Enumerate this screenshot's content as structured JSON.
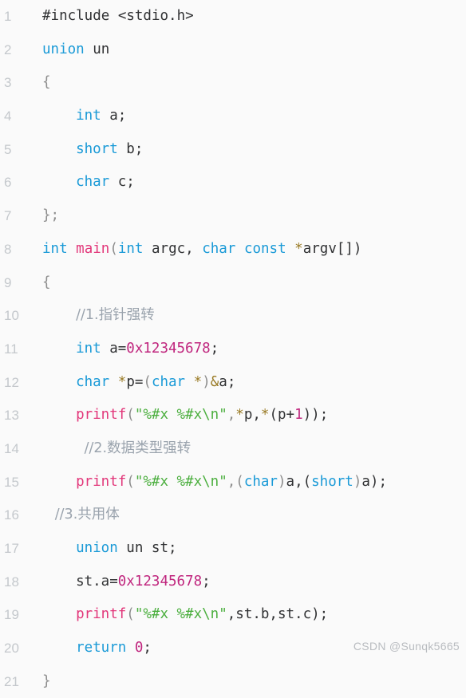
{
  "editor": {
    "language": "c",
    "background_color": "#fafafa",
    "line_number_color": "#c4c8cc",
    "default_text_color": "#303133",
    "token_colors": {
      "keyword": "#1a9ad7",
      "function": "#e2377a",
      "string": "#4caf3f",
      "number": "#c0267e",
      "comment": "#9aa3ad",
      "punctuation": "#8d8d8d",
      "operator": "#9a7b26"
    },
    "first_visible_line": 1,
    "last_visible_line": 21,
    "lines": [
      {
        "number": "1",
        "indent": 0,
        "tokens": [
          {
            "text": "#include <stdio.h>",
            "type": "plain"
          }
        ]
      },
      {
        "number": "2",
        "indent": 0,
        "tokens": [
          {
            "text": "union",
            "type": "keyword"
          },
          {
            "text": " un",
            "type": "plain"
          }
        ]
      },
      {
        "number": "3",
        "indent": 0,
        "tokens": [
          {
            "text": "{",
            "type": "punctuation"
          }
        ]
      },
      {
        "number": "4",
        "indent": 4,
        "tokens": [
          {
            "text": "int",
            "type": "keyword"
          },
          {
            "text": " a;",
            "type": "plain"
          }
        ]
      },
      {
        "number": "5",
        "indent": 4,
        "tokens": [
          {
            "text": "short",
            "type": "keyword"
          },
          {
            "text": " b;",
            "type": "plain"
          }
        ]
      },
      {
        "number": "6",
        "indent": 4,
        "tokens": [
          {
            "text": "char",
            "type": "keyword"
          },
          {
            "text": " c;",
            "type": "plain"
          }
        ]
      },
      {
        "number": "7",
        "indent": 0,
        "tokens": [
          {
            "text": "};",
            "type": "punctuation"
          }
        ]
      },
      {
        "number": "8",
        "indent": 0,
        "tokens": [
          {
            "text": "int",
            "type": "keyword"
          },
          {
            "text": " ",
            "type": "plain"
          },
          {
            "text": "main",
            "type": "function"
          },
          {
            "text": "(",
            "type": "punctuation"
          },
          {
            "text": "int",
            "type": "keyword"
          },
          {
            "text": " argc, ",
            "type": "plain"
          },
          {
            "text": "char",
            "type": "keyword"
          },
          {
            "text": " ",
            "type": "plain"
          },
          {
            "text": "const",
            "type": "keyword"
          },
          {
            "text": " ",
            "type": "plain"
          },
          {
            "text": "*",
            "type": "operator"
          },
          {
            "text": "argv[])",
            "type": "plain"
          }
        ]
      },
      {
        "number": "9",
        "indent": 0,
        "tokens": [
          {
            "text": "{",
            "type": "punctuation"
          }
        ]
      },
      {
        "number": "10",
        "indent": 4,
        "tokens": [
          {
            "text": "//1.指针强转",
            "type": "comment"
          }
        ]
      },
      {
        "number": "11",
        "indent": 4,
        "tokens": [
          {
            "text": "int",
            "type": "keyword"
          },
          {
            "text": " a=",
            "type": "plain"
          },
          {
            "text": "0x12345678",
            "type": "number"
          },
          {
            "text": ";",
            "type": "plain"
          }
        ]
      },
      {
        "number": "12",
        "indent": 4,
        "tokens": [
          {
            "text": "char",
            "type": "keyword"
          },
          {
            "text": " ",
            "type": "plain"
          },
          {
            "text": "*",
            "type": "operator"
          },
          {
            "text": "p=",
            "type": "plain"
          },
          {
            "text": "(",
            "type": "punctuation"
          },
          {
            "text": "char",
            "type": "keyword"
          },
          {
            "text": " ",
            "type": "plain"
          },
          {
            "text": "*",
            "type": "operator"
          },
          {
            "text": ")",
            "type": "punctuation"
          },
          {
            "text": "&",
            "type": "operator"
          },
          {
            "text": "a;",
            "type": "plain"
          }
        ]
      },
      {
        "number": "13",
        "indent": 4,
        "tokens": [
          {
            "text": "printf",
            "type": "function"
          },
          {
            "text": "(",
            "type": "punctuation"
          },
          {
            "text": "\"%#x %#x\\n\"",
            "type": "string"
          },
          {
            "text": ",",
            "type": "punctuation"
          },
          {
            "text": "*",
            "type": "operator"
          },
          {
            "text": "p,",
            "type": "plain"
          },
          {
            "text": "*",
            "type": "operator"
          },
          {
            "text": "(p+",
            "type": "plain"
          },
          {
            "text": "1",
            "type": "number"
          },
          {
            "text": "));",
            "type": "plain"
          }
        ]
      },
      {
        "number": "14",
        "indent": 5,
        "tokens": [
          {
            "text": "//2.数据类型强转",
            "type": "comment"
          }
        ]
      },
      {
        "number": "15",
        "indent": 4,
        "tokens": [
          {
            "text": "printf",
            "type": "function"
          },
          {
            "text": "(",
            "type": "punctuation"
          },
          {
            "text": "\"%#x %#x\\n\"",
            "type": "string"
          },
          {
            "text": ",(",
            "type": "punctuation"
          },
          {
            "text": "char",
            "type": "keyword"
          },
          {
            "text": ")",
            "type": "punctuation"
          },
          {
            "text": "a,(",
            "type": "plain"
          },
          {
            "text": "short",
            "type": "keyword"
          },
          {
            "text": ")",
            "type": "punctuation"
          },
          {
            "text": "a);",
            "type": "plain"
          }
        ]
      },
      {
        "number": "16",
        "indent": 1.5,
        "tokens": [
          {
            "text": "//3.共用体",
            "type": "comment"
          }
        ]
      },
      {
        "number": "17",
        "indent": 4,
        "tokens": [
          {
            "text": "union",
            "type": "keyword"
          },
          {
            "text": " un st;",
            "type": "plain"
          }
        ]
      },
      {
        "number": "18",
        "indent": 4,
        "tokens": [
          {
            "text": "st.a=",
            "type": "plain"
          },
          {
            "text": "0x12345678",
            "type": "number"
          },
          {
            "text": ";",
            "type": "plain"
          }
        ]
      },
      {
        "number": "19",
        "indent": 4,
        "tokens": [
          {
            "text": "printf",
            "type": "function"
          },
          {
            "text": "(",
            "type": "punctuation"
          },
          {
            "text": "\"%#x %#x\\n\"",
            "type": "string"
          },
          {
            "text": ",st.b,st.c);",
            "type": "plain"
          }
        ]
      },
      {
        "number": "20",
        "indent": 4,
        "tokens": [
          {
            "text": "return",
            "type": "keyword"
          },
          {
            "text": " ",
            "type": "plain"
          },
          {
            "text": "0",
            "type": "number"
          },
          {
            "text": ";",
            "type": "plain"
          }
        ]
      },
      {
        "number": "21",
        "indent": 0,
        "tokens": [
          {
            "text": "}",
            "type": "punctuation"
          }
        ]
      }
    ]
  },
  "watermark": {
    "text": "CSDN @Sunqk5665"
  }
}
